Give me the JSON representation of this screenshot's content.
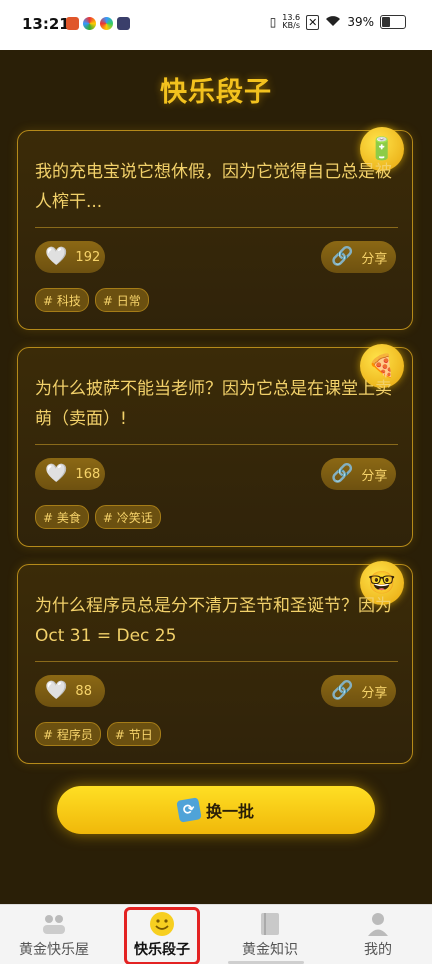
{
  "status_bar": {
    "time": "13:21",
    "net_speed_value": "13.6",
    "net_speed_unit": "KB/s",
    "battery": "39%"
  },
  "page_title": "快乐段子",
  "jokes": [
    {
      "icon": "battery-icon",
      "emoji": "🔋",
      "text": "我的充电宝说它想休假，因为它觉得自己总是被人榨干...",
      "likes": "192",
      "share_label": "分享",
      "tags": [
        "# 科技",
        "# 日常"
      ]
    },
    {
      "icon": "pizza-icon",
      "emoji": "🍕",
      "text": "为什么披萨不能当老师？因为它总是在课堂上卖萌（卖面）!",
      "likes": "168",
      "share_label": "分享",
      "tags": [
        "# 美食",
        "# 冷笑话"
      ]
    },
    {
      "icon": "nerd-face-icon",
      "emoji": "🤓",
      "text": "为什么程序员总是分不清万圣节和圣诞节？因为 Oct 31 = Dec 25",
      "likes": "88",
      "share_label": "分享",
      "tags": [
        "# 程序员",
        "# 节日"
      ]
    }
  ],
  "refresh_button": {
    "label": "换一批",
    "icon": "refresh-icon"
  },
  "tabs": [
    {
      "label": "黄金快乐屋",
      "icon": "family-icon"
    },
    {
      "label": "快乐段子",
      "icon": "smiley-icon"
    },
    {
      "label": "黄金知识",
      "icon": "book-icon"
    },
    {
      "label": "我的",
      "icon": "user-icon"
    }
  ],
  "colors": {
    "accent": "#f3c21e",
    "background": "#2a1f07",
    "active_highlight": "#e32222"
  }
}
